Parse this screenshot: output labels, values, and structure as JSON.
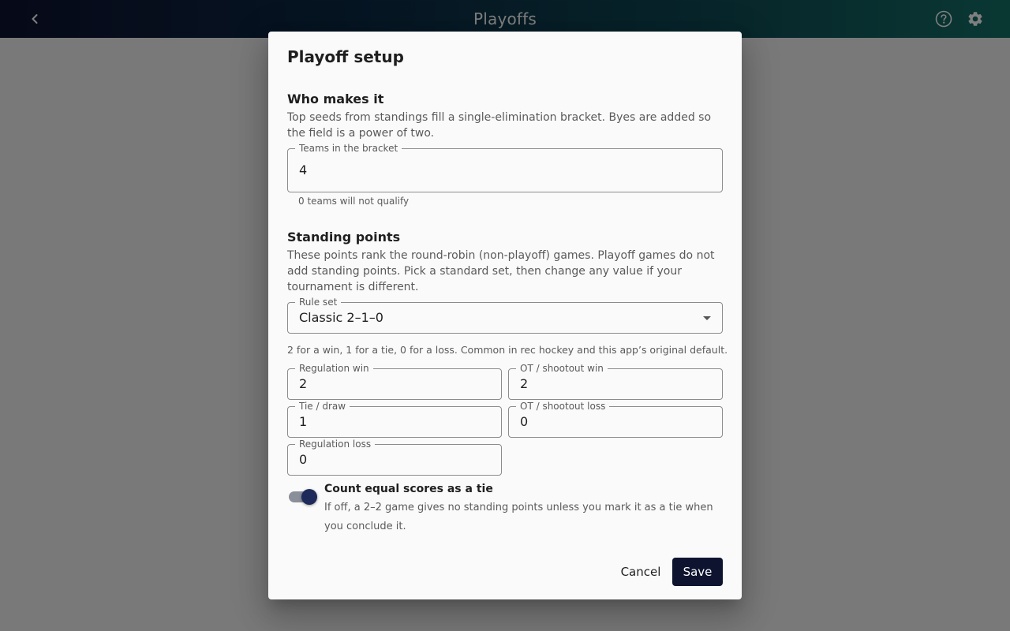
{
  "appbar": {
    "title": "Playoffs",
    "back_icon": "chevron-left-icon",
    "help_icon": "help-circle-icon",
    "settings_icon": "gear-icon",
    "gradient": [
      "#0d1230",
      "#137066"
    ]
  },
  "dialog": {
    "title": "Playoff setup",
    "who": {
      "heading": "Who makes it",
      "description": "Top seeds from standings fill a single-elimination bracket. Byes are added so the field is a power of two.",
      "teams_label": "Teams in the bracket",
      "teams_value": "4",
      "teams_helper": "0 teams will not qualify"
    },
    "standing": {
      "heading": "Standing points",
      "description": "These points rank the round-robin (non-playoff) games. Playoff games do not add standing points. Pick a standard set, then change any value if your tournament is different.",
      "rule_set_label": "Rule set",
      "rule_set_value": "Classic 2–1–0",
      "rule_set_helper": "2 for a win, 1 for a tie, 0 for a loss. Common in rec hockey and this app’s original default.",
      "fields": {
        "regulation_win": {
          "label": "Regulation win",
          "value": "2"
        },
        "ot_win": {
          "label": "OT / shootout win",
          "value": "2"
        },
        "tie": {
          "label": "Tie / draw",
          "value": "1"
        },
        "ot_loss": {
          "label": "OT / shootout loss",
          "value": "0"
        },
        "regulation_loss": {
          "label": "Regulation loss",
          "value": "0"
        }
      },
      "tie_toggle": {
        "label": "Count equal scores as a tie",
        "description": "If off, a 2–2 game gives no standing points unless you mark it as a tie when you conclude it.",
        "on": true
      }
    },
    "actions": {
      "cancel": "Cancel",
      "save": "Save"
    },
    "colors": {
      "primary": "#0e1430",
      "toggle_thumb": "#1e2a5a"
    }
  }
}
